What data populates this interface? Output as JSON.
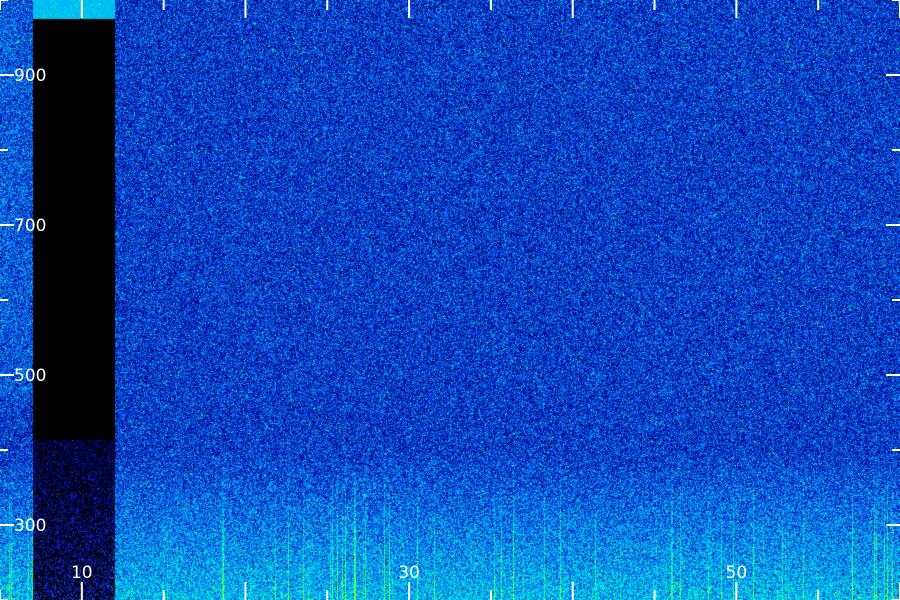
{
  "chart_data": {
    "type": "heatmap",
    "title": "",
    "xlabel": "",
    "ylabel": "",
    "xlim": [
      5,
      60
    ],
    "ylim": [
      200,
      1000
    ],
    "x_ticks": [
      10,
      30,
      50
    ],
    "y_ticks": [
      300,
      500,
      700,
      900
    ],
    "x_tick_labels": [
      "10",
      "30",
      "50"
    ],
    "y_tick_labels": [
      "300",
      "500",
      "700",
      "900"
    ],
    "grid": false,
    "legend": "none",
    "colormap": [
      "#000000",
      "#00007a",
      "#1030d0",
      "#00a8ff",
      "#00ffd0",
      "#60ff40",
      "#d0ff20"
    ],
    "background_level": 0.32,
    "low_band": {
      "y_max": 400,
      "level": 0.55
    },
    "gap": {
      "x_start": 7,
      "x_end": 12,
      "y_max": 975,
      "note_level": 0.0
    },
    "gap_top_block": {
      "x_start": 7,
      "x_end": 12,
      "y_min": 975,
      "level": 0.55
    }
  },
  "colors": {
    "tick": "#ffffff",
    "background": "#000000"
  }
}
